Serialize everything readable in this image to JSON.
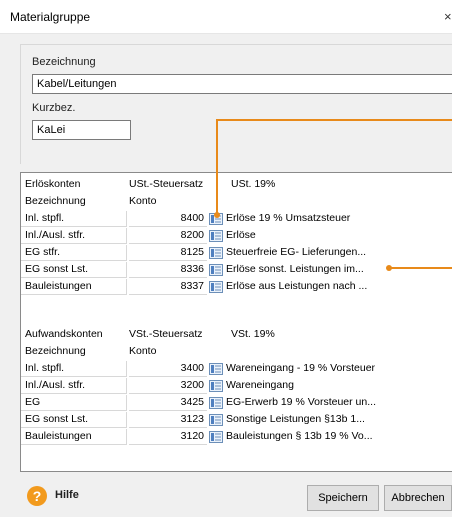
{
  "window": {
    "title": "Materialgruppe",
    "close_glyph": "×"
  },
  "form": {
    "bezeichnung_label": "Bezeichnung",
    "bezeichnung_value": "Kabel/Leitungen",
    "kurzbez_label": "Kurzbez.",
    "kurzbez_value": "KaLei"
  },
  "erloes": {
    "header": {
      "col1": "Erlöskonten",
      "col2": "USt.-Steuersatz",
      "col3": "USt. 19%"
    },
    "subheader": {
      "col1": "Bezeichnung",
      "col2": "Konto"
    },
    "rows": [
      {
        "name": "Inl. stpfl.",
        "konto": "8400",
        "desc": "Erlöse 19 % Umsatzsteuer"
      },
      {
        "name": "Inl./Ausl. stfr.",
        "konto": "8200",
        "desc": "Erlöse"
      },
      {
        "name": "EG stfr.",
        "konto": "8125",
        "desc": "Steuerfreie EG- Lieferungen..."
      },
      {
        "name": "EG sonst Lst.",
        "konto": "8336",
        "desc": "Erlöse sonst. Leistungen im..."
      },
      {
        "name": "Bauleistungen",
        "konto": "8337",
        "desc": "Erlöse aus Leistungen nach ..."
      }
    ]
  },
  "aufwand": {
    "header": {
      "col1": "Aufwandskonten",
      "col2": "VSt.-Steuersatz",
      "col3": "VSt. 19%"
    },
    "subheader": {
      "col1": "Bezeichnung",
      "col2": "Konto"
    },
    "rows": [
      {
        "name": "Inl. stpfl.",
        "konto": "3400",
        "desc": "Wareneingang - 19 % Vorsteuer"
      },
      {
        "name": "Inl./Ausl. stfr.",
        "konto": "3200",
        "desc": "Wareneingang"
      },
      {
        "name": "EG",
        "konto": "3425",
        "desc": "EG-Erwerb 19 % Vorsteuer un..."
      },
      {
        "name": "EG sonst Lst.",
        "konto": "3123",
        "desc": "Sonstige Leistungen §13b  1..."
      },
      {
        "name": "Bauleistungen",
        "konto": "3120",
        "desc": "Bauleistungen § 13b 19 % Vo..."
      }
    ]
  },
  "footer": {
    "help_label": "Hilfe",
    "help_icon": "question-icon",
    "save_label": "Speichern",
    "cancel_label": "Abbrechen"
  },
  "colors": {
    "accent": "#e88a1a",
    "help_icon": "#f29a1d"
  }
}
